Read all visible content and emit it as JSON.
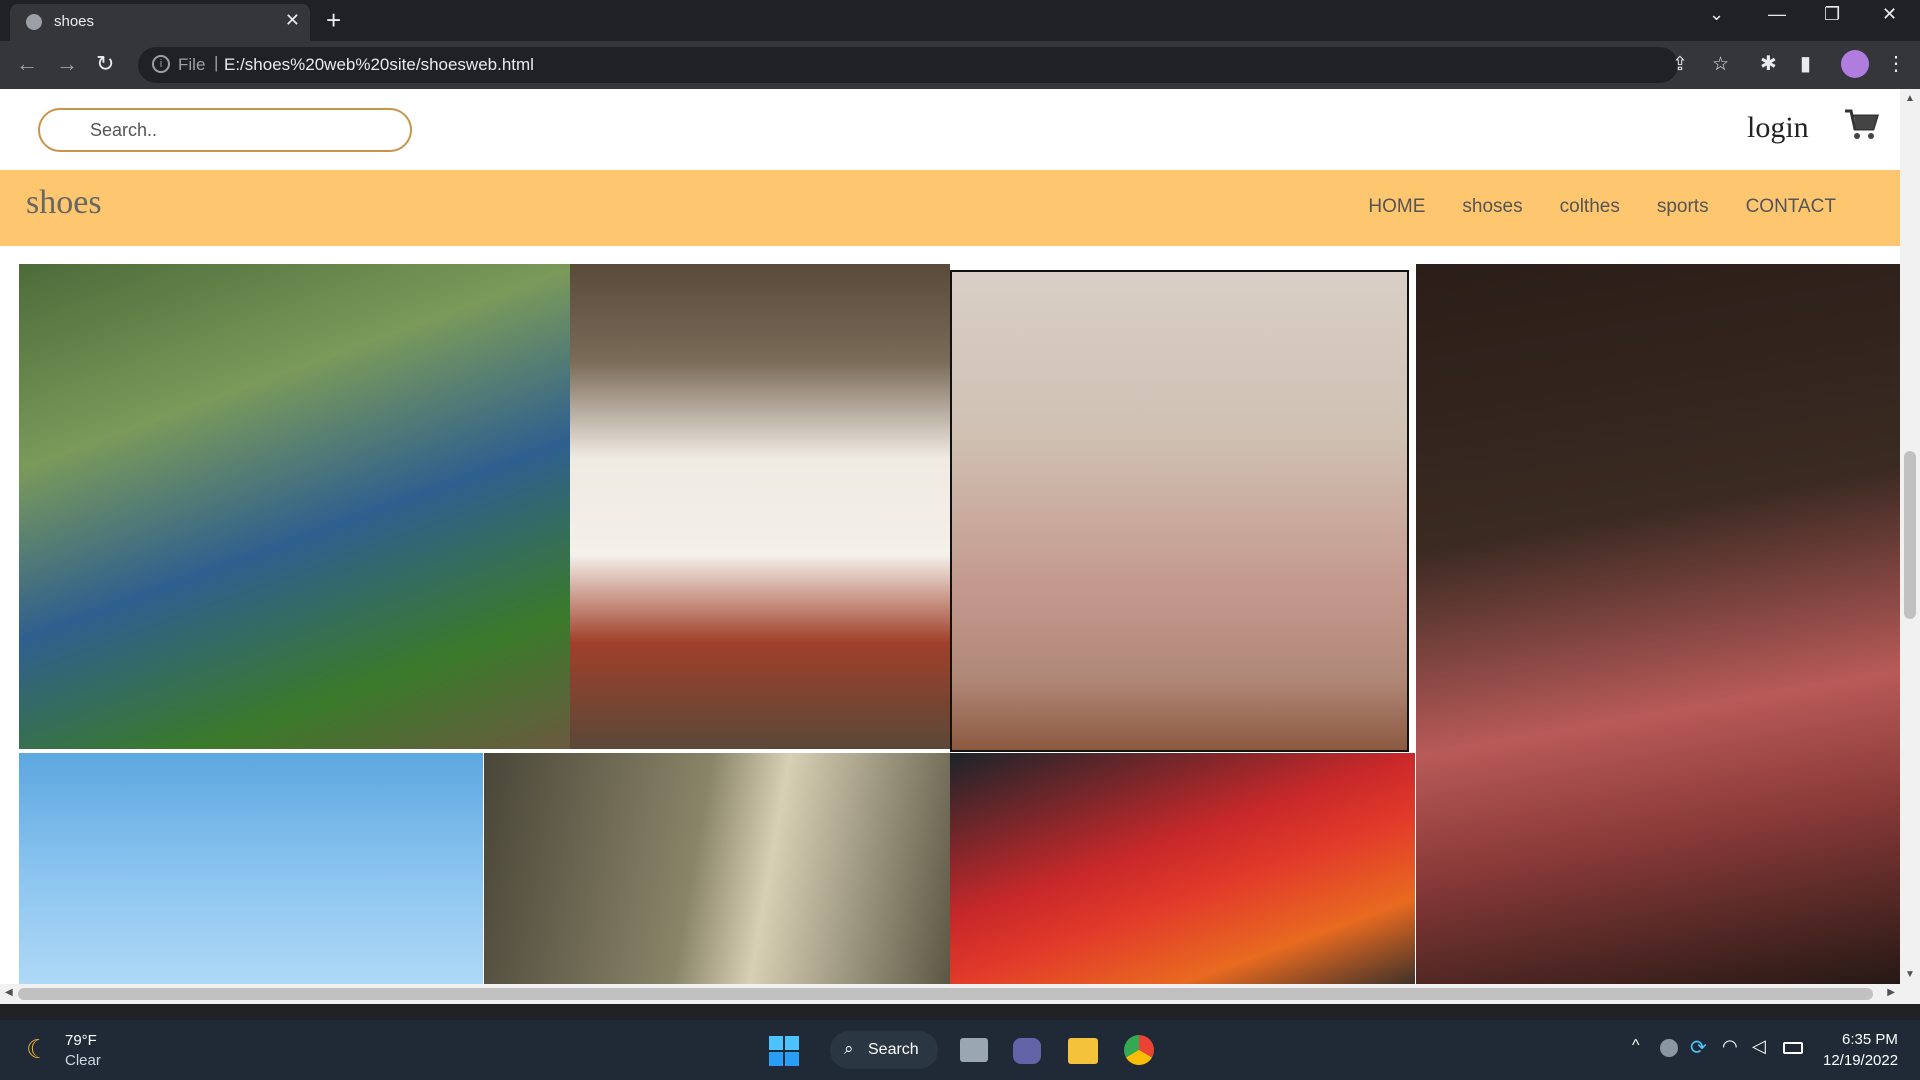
{
  "browser": {
    "tab_title": "shoes",
    "url_scheme": "File",
    "url": "E:/shoes%20web%20site/shoesweb.html"
  },
  "site": {
    "search_placeholder": "Search..",
    "login_label": "login",
    "brand": "shoes",
    "nav": [
      "HOME",
      "shoses",
      "colthes",
      "sports",
      "CONTACT"
    ]
  },
  "gallery": {
    "tiles": [
      {
        "name": "photo-girl-bridge",
        "colors": [
          "#6a8f4a",
          "#2f5f8f",
          "#3a7a2a"
        ]
      },
      {
        "name": "photo-sneakers-socks",
        "colors": [
          "#6b5a48",
          "#f2eee8",
          "#a0402a"
        ]
      },
      {
        "name": "photo-girl-bedroom",
        "colors": [
          "#d8c4b4",
          "#c49a8e",
          "#e0b030"
        ]
      },
      {
        "name": "photo-jordan-closeup",
        "colors": [
          "#3a2a22",
          "#b85a58",
          "#1e1612"
        ]
      },
      {
        "name": "photo-man-bike",
        "colors": [
          "#6fb3e8",
          "#a8d4f5",
          "#ffffff"
        ]
      },
      {
        "name": "photo-white-sneaker",
        "colors": [
          "#6a6450",
          "#cfc6a8",
          "#3c3a2c"
        ]
      },
      {
        "name": "photo-red-jordans",
        "colors": [
          "#1e2a30",
          "#d83028",
          "#e86a20"
        ]
      }
    ]
  },
  "taskbar": {
    "weather_temp": "79°F",
    "weather_desc": "Clear",
    "search_label": "Search",
    "time": "6:35 PM",
    "date": "12/19/2022"
  }
}
